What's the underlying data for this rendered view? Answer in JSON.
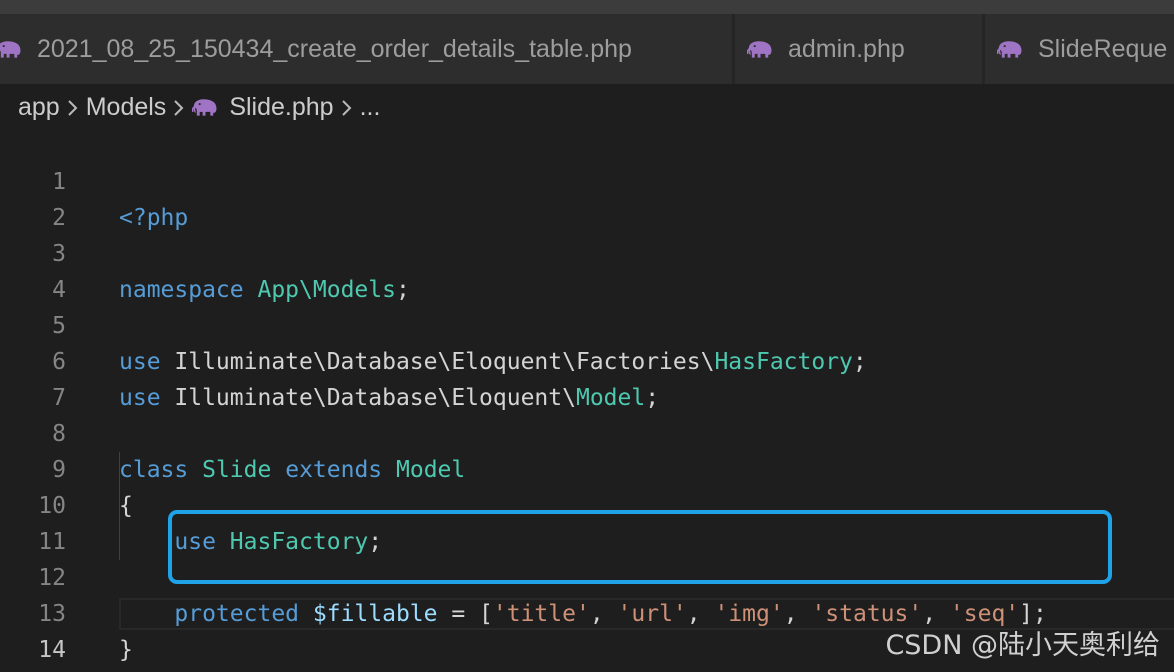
{
  "tabs": [
    {
      "label": "2021_08_25_150434_create_order_details_table.php",
      "icon": "php-elephant-icon"
    },
    {
      "label": "admin.php",
      "icon": "php-elephant-icon"
    },
    {
      "label": "SlideReque",
      "icon": "php-elephant-icon"
    }
  ],
  "breadcrumb": {
    "items": [
      "app",
      "Models",
      "Slide.php",
      "..."
    ],
    "separator_icon": "chevron-right-icon"
  },
  "editor": {
    "active_line": "14",
    "lines": [
      {
        "number": "1",
        "tokens": [
          "<?php"
        ]
      },
      {
        "number": "2",
        "tokens": []
      },
      {
        "number": "3",
        "tokens": [
          "namespace",
          " ",
          "App\\Models",
          ";"
        ]
      },
      {
        "number": "4",
        "tokens": []
      },
      {
        "number": "5",
        "tokens": [
          "use",
          " Illuminate\\Database\\Eloquent\\Factories\\",
          "HasFactory",
          ";"
        ]
      },
      {
        "number": "6",
        "tokens": [
          "use",
          " Illuminate\\Database\\Eloquent\\",
          "Model",
          ";"
        ]
      },
      {
        "number": "7",
        "tokens": []
      },
      {
        "number": "8",
        "tokens": [
          "class",
          " ",
          "Slide",
          " ",
          "extends",
          " ",
          "Model"
        ]
      },
      {
        "number": "9",
        "tokens": [
          "{"
        ]
      },
      {
        "number": "10",
        "tokens": [
          "    ",
          "use",
          " ",
          "HasFactory",
          ";"
        ]
      },
      {
        "number": "11",
        "tokens": []
      },
      {
        "number": "12",
        "tokens": [
          "    ",
          "protected",
          " ",
          "$fillable",
          " = [",
          "'title'",
          ", ",
          "'url'",
          ", ",
          "'img'",
          ", ",
          "'status'",
          ", ",
          "'seq'",
          "];"
        ]
      },
      {
        "number": "13",
        "tokens": [
          "}"
        ]
      },
      {
        "number": "14",
        "tokens": []
      }
    ]
  },
  "colors": {
    "keyword": "#569cd6",
    "type": "#4ec9b0",
    "variable": "#9cdcfe",
    "string": "#ce9178",
    "highlight_border": "#1fa2e8",
    "php_icon": "#a074c4"
  },
  "watermark": "CSDN @陆小天奥利给"
}
